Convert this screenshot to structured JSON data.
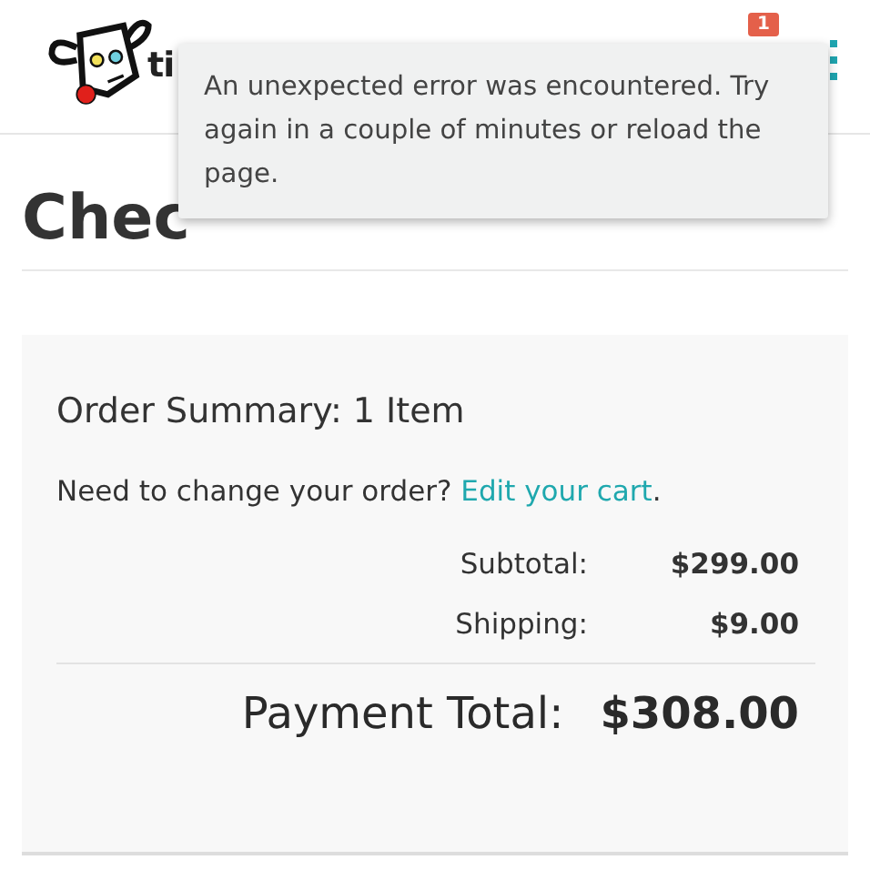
{
  "header": {
    "brand_text": "ti",
    "cart_count": "1"
  },
  "toast": {
    "message": "An unexpected error was encountered. Try again in a couple of minutes or reload the page."
  },
  "page_title": "Chec",
  "summary": {
    "heading": "Order Summary: 1 Item",
    "change_prompt": "Need to change your order?",
    "edit_link": "Edit your cart",
    "edit_suffix": ".",
    "lines": [
      {
        "label": "Subtotal:",
        "value": "$299.00"
      },
      {
        "label": "Shipping:",
        "value": "$9.00"
      }
    ],
    "total": {
      "label": "Payment Total:",
      "value": "$308.00"
    }
  }
}
